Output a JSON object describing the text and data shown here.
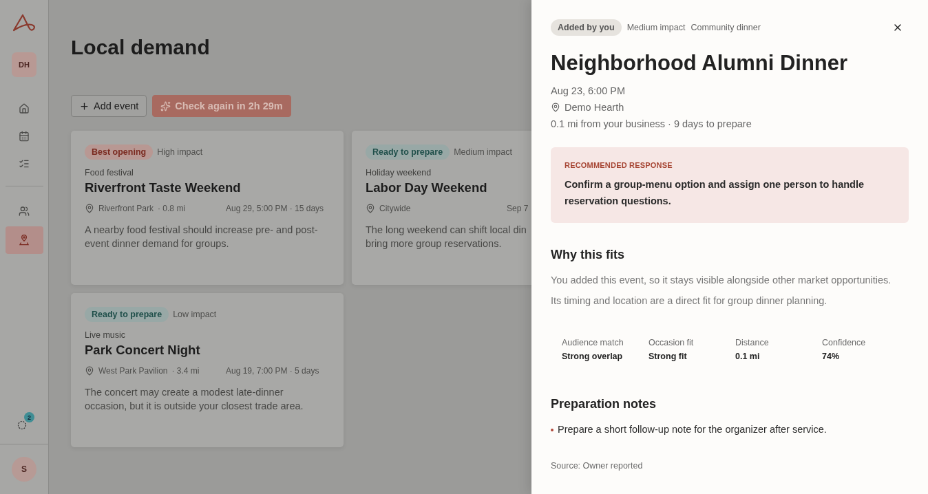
{
  "sidebar": {
    "workspace": "DH",
    "nav": [
      {
        "selected": false
      },
      {
        "selected": false
      },
      {
        "selected": false
      },
      {
        "selected": false
      },
      {
        "selected": true
      }
    ],
    "badge": "2",
    "user": "S"
  },
  "page": {
    "title": "Local demand",
    "actions": [
      {
        "kind": "add",
        "label": "Add event"
      },
      {
        "kind": "check",
        "label": "Check again in 2h 29m"
      }
    ]
  },
  "cards": [
    {
      "status": {
        "kind": "best",
        "label": "Best opening"
      },
      "impact": "High impact",
      "category": "Food festival",
      "title": "Riverfront Taste Weekend",
      "place": "Riverfront Park",
      "distance": "· 0.8 mi",
      "when": "Aug 29, 5:00 PM · 15 days",
      "description": [
        "A nearby food festival should increase pre- and post-",
        "event dinner demand for groups."
      ]
    },
    {
      "status": {
        "kind": "ready",
        "label": "Ready to prepare"
      },
      "impact": "Medium impact",
      "category": "Holiday weekend",
      "title": "Labor Day Weekend",
      "place": "Citywide",
      "when": "Sep 7",
      "description": [
        "The long weekend can shift local din",
        "bring more group reservations."
      ]
    },
    {
      "status": {
        "kind": "ready",
        "label": "Ready to prepare"
      },
      "impact": "Low impact",
      "category": "Live music",
      "title": "Park Concert Night",
      "place": "West Park Pavilion",
      "distance": "· 3.4 mi",
      "when": "Aug 19, 7:00 PM · 5 days",
      "description": [
        "The concert may create a modest late-dinner",
        "occasion, but it is outside your closest trade area."
      ]
    }
  ],
  "drawer": {
    "tags": [
      {
        "kind": "pill",
        "label": "Added by you"
      },
      {
        "kind": "plain",
        "label": "Medium impact"
      },
      {
        "kind": "plain",
        "label": "Community dinner"
      }
    ],
    "title": "Neighborhood Alumni Dinner",
    "when": "Aug 23, 6:00 PM",
    "place": "Demo Hearth",
    "distance": "0.1 mi from your business · 9 days to prepare",
    "recommendation": {
      "label": "RECOMMENDED RESPONSE",
      "text": "Confirm a group-menu option and assign one person to handle reservation questions."
    },
    "why": {
      "heading": "Why this fits",
      "paragraphs": [
        "You added this event, so it stays visible alongside other market opportunities.",
        "Its timing and location are a direct fit for group dinner planning."
      ]
    },
    "metrics": [
      {
        "label": "Audience match",
        "value": "Strong overlap"
      },
      {
        "label": "Occasion fit",
        "value": "Strong fit"
      },
      {
        "label": "Distance",
        "value": "0.1 mi"
      },
      {
        "label": "Confidence",
        "value": "74%"
      }
    ],
    "notes": {
      "heading": "Preparation notes",
      "items": [
        "Prepare a short follow-up note for the organizer after service."
      ]
    },
    "source": "Source: Owner reported"
  }
}
